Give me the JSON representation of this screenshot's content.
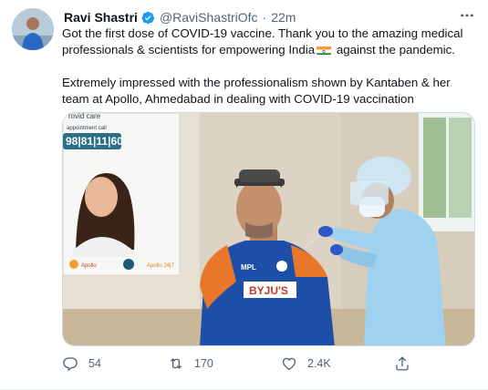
{
  "tweet": {
    "author_name": "Ravi Shastri",
    "handle": "@RaviShastriOfc",
    "separator": "·",
    "time": "22m",
    "text_line1_before": "Got the first dose of COVID-19 vaccine. Thank you to the amazing medical professionals & scientists for empowering India",
    "text_line1_after": "against the pandemic.",
    "text_para2": "Extremely impressed with the professionalism shown by Kantaben & her team at Apollo, Ahmedabad in dealing with COVID-19 vaccination",
    "flag_icon": "india-flag-emoji"
  },
  "media": {
    "poster_partial_text": "rovid care",
    "poster_subtext": "appointment call",
    "poster_phone": "98|81|11|60",
    "jersey_text": "BYJU'S",
    "jersey_brand": "MPL",
    "poster_logo_1": "Apollo",
    "poster_logo_2": "Apollo 24|7"
  },
  "actions": {
    "replies": "54",
    "retweets": "170",
    "likes": "2.4K"
  },
  "colors": {
    "verified": "#1d9bf0",
    "muted": "#536471",
    "jersey_blue": "#1e4fa8",
    "jersey_orange": "#e9772a",
    "ppe_blue": "#9fd2ee"
  }
}
